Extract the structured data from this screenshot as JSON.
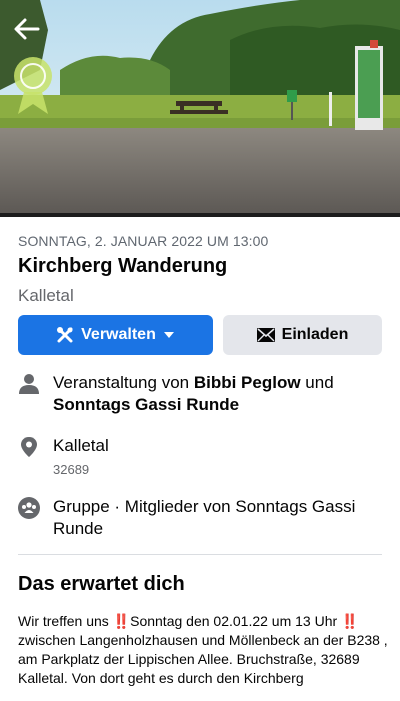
{
  "event": {
    "datetime": "SONNTAG, 2. JANUAR 2022 UM 13:00",
    "title": "Kirchberg Wanderung",
    "location": "Kalletal"
  },
  "actions": {
    "manage_label": "Verwalten",
    "invite_label": "Einladen"
  },
  "details": {
    "host_prefix": "Veranstaltung von ",
    "host_1": "Bibbi Peglow",
    "host_and": " und ",
    "host_2": "Sonntags Gassi Runde",
    "place_name": "Kalletal",
    "place_postcode": "32689",
    "group_text": "Gruppe · Mitglieder von Sonntags Gassi Runde"
  },
  "about": {
    "title": "Das erwartet dich",
    "part_1": "Wir treffen uns ",
    "emoji": "‼️",
    "part_2": "Sonntag den 02.01.22 um 13 Uhr ",
    "part_3": "zwischen Langenholzhausen und Möllenbeck an der B238 , am Parkplatz der Lippischen Allee. Bruchstraße, 32689 Kalletal. Von dort geht es durch den Kirchberg"
  },
  "icons": {
    "back": "arrow-left-icon",
    "manage": "tools-icon",
    "caret": "caret-down-icon",
    "invite": "envelope-icon",
    "host": "person-icon",
    "place": "location-pin-icon",
    "group": "group-icon"
  },
  "colors": {
    "primary": "#1b74e4",
    "secondary": "#e4e6eb",
    "muted": "#65676b"
  }
}
